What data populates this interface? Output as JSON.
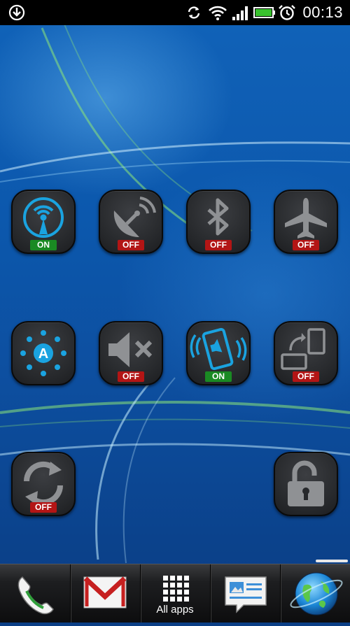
{
  "status_bar": {
    "time": "00:13",
    "icons": [
      "download-icon",
      "sync-icon",
      "wifi-icon",
      "signal-icon",
      "battery-icon",
      "alarm-icon"
    ]
  },
  "toggles": [
    {
      "name": "wifi-hotspot",
      "icon": "wifi-tether-icon",
      "state": "ON"
    },
    {
      "name": "gps",
      "icon": "satellite-dish-icon",
      "state": "OFF"
    },
    {
      "name": "bluetooth",
      "icon": "bluetooth-icon",
      "state": "OFF"
    },
    {
      "name": "airplane-mode",
      "icon": "airplane-icon",
      "state": "OFF"
    },
    {
      "name": "auto-brightness",
      "icon": "brightness-auto-icon",
      "state": ""
    },
    {
      "name": "sound",
      "icon": "speaker-mute-icon",
      "state": "OFF"
    },
    {
      "name": "vibrate",
      "icon": "vibrate-phone-icon",
      "state": "ON"
    },
    {
      "name": "auto-rotate",
      "icon": "screen-rotate-icon",
      "state": "OFF"
    },
    {
      "name": "sync",
      "icon": "sync-arrows-icon",
      "state": "OFF"
    },
    {
      "name": "screen-lock",
      "icon": "padlock-icon",
      "state": ""
    }
  ],
  "dock": {
    "phone_icon": "phone-icon",
    "mail_icon": "gmail-icon",
    "all_apps_label": "All apps",
    "messages_icon": "messages-icon",
    "browser_icon": "globe-icon"
  },
  "colors": {
    "on_badge": "#1a8a23",
    "off_badge": "#b31515",
    "active_icon": "#1aa3e0",
    "inactive_icon": "#8f9194"
  }
}
